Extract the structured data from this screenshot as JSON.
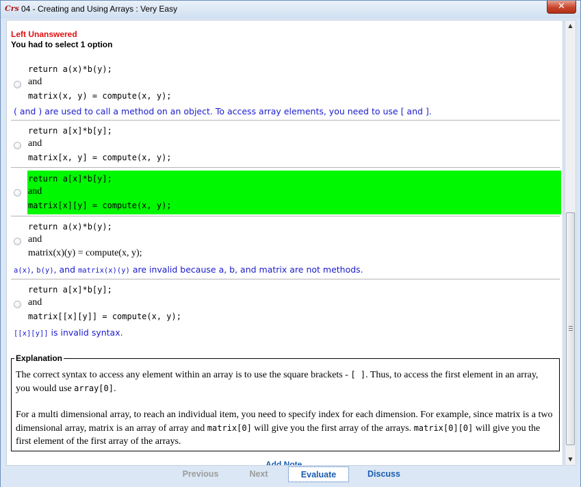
{
  "window": {
    "app_icon_text": "Crs",
    "title": "04 - Creating and Using Arrays  :  Very Easy",
    "close_label": "✕"
  },
  "question": {
    "status": "Left Unanswered",
    "instruction": "You had to select 1 option"
  },
  "options": [
    {
      "lines": [
        "return a(x)*b(y);",
        "and",
        "matrix(x, y) = compute(x, y);"
      ],
      "correct": false,
      "feedback": "( and ) are used to call a method on an object. To access array elements, you need to use [ and ]."
    },
    {
      "lines": [
        "return a[x]*b[y];",
        "and",
        "matrix[x, y] = compute(x, y);"
      ],
      "correct": false,
      "feedback": ""
    },
    {
      "lines": [
        "return a[x]*b[y];",
        "and",
        "matrix[x][y] = compute(x, y);"
      ],
      "correct": true,
      "feedback": ""
    },
    {
      "lines": [
        "return a(x)*b(y);",
        "and",
        "matrix(x)(y) = compute(x, y);"
      ],
      "correct": false,
      "feedback_parts": [
        "a(x)",
        ", ",
        "b(y)",
        ", and ",
        "matrix(x)(y)",
        " are invalid because a, b, and matrix are not methods."
      ]
    },
    {
      "lines": [
        "return a[x]*b[y];",
        "and",
        "matrix[[x][y]] = compute(x, y);"
      ],
      "correct": false,
      "feedback_parts": [
        "[[x][y]]",
        " is invalid syntax."
      ]
    }
  ],
  "explanation": {
    "heading": "Explanation",
    "p1_a": "The correct syntax to access any element within an array is to use the square brackets - ",
    "p1_code1": "[ ]",
    "p1_b": ". Thus, to access the first element in an array, you would use ",
    "p1_code2": "array[0]",
    "p1_c": ".",
    "p2_a": "For a multi dimensional array, to reach an individual item, you need to specify index for each dimension. For example, since matrix is a two dimensional array, matrix is an array of array and ",
    "p2_code1": "matrix[0]",
    "p2_b": " will give you the first array of the arrays. ",
    "p2_code2": "matrix[0][0]",
    "p2_c": " will give you the first element of the first array of the arrays."
  },
  "add_note": "Add Note",
  "footer": {
    "previous": "Previous",
    "next": "Next",
    "evaluate": "Evaluate",
    "discuss": "Discuss"
  },
  "colors": {
    "correct_highlight": "#00f800",
    "status_red": "#e01010",
    "feedback_blue": "#1a1acc",
    "link_blue": "#1a5cb0"
  }
}
